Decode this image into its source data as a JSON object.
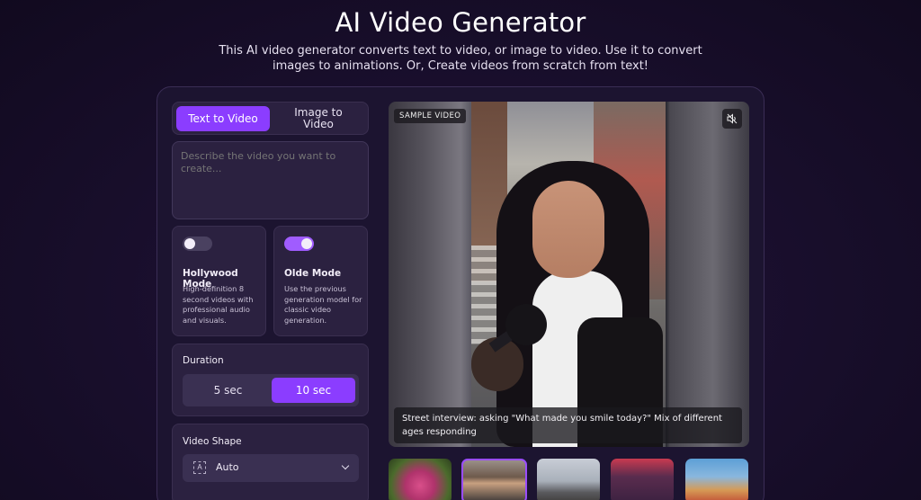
{
  "header": {
    "title": "AI Video Generator",
    "subtitle": "This AI video generator converts text to video, or image to video. Use it to convert images to animations. Or, Create videos from scratch from text!"
  },
  "tabs": {
    "text_to_video": "Text to Video",
    "image_to_video": "Image to\nVideo",
    "active": "Text to Video"
  },
  "prompt": {
    "placeholder": "Describe the video you want to create...",
    "value": ""
  },
  "modes": {
    "hollywood": {
      "title": "Hollywood Mode",
      "description": "High-definition 8 second videos with professional audio and visuals.",
      "enabled": false
    },
    "olde": {
      "title": "Olde Mode",
      "description": "Use the previous generation model for classic video generation.",
      "enabled": true
    }
  },
  "duration": {
    "label": "Duration",
    "options": [
      "5 sec",
      "10 sec"
    ],
    "selected": "10 sec"
  },
  "shape": {
    "label": "Video Shape",
    "icon_letter": "A",
    "value": "Auto"
  },
  "video": {
    "badge": "SAMPLE VIDEO",
    "caption": "Street interview: asking \"What made you smile today?\" Mix of different ages responding",
    "muted": true
  },
  "thumbnails": [
    "rose-thumbnail",
    "street-interview-thumbnail",
    "car-thumbnail",
    "anime-character-thumbnail",
    "dog-thumbnail"
  ],
  "colors": {
    "accent": "#8b3dff",
    "background": "#1a0f2e",
    "card": "#2b2140"
  }
}
